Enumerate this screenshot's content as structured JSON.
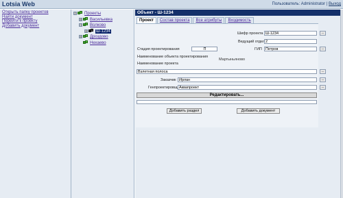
{
  "app": {
    "title": "Lotsia Web"
  },
  "header": {
    "user_prefix": "Пользователь: Administrator",
    "separator": "|",
    "exit_link": "Выход"
  },
  "left_menu": [
    {
      "label": "Открыть папку проектов"
    },
    {
      "label": "Найти документ"
    },
    {
      "label": "Перейти к проекту"
    },
    {
      "label": "Добавить документ"
    }
  ],
  "tree": {
    "root": {
      "toggle": "⊟",
      "label": "Проекты"
    },
    "items": [
      {
        "toggle": "⊞",
        "label": "Васильевка"
      },
      {
        "toggle": "⊟",
        "label": "Волково"
      },
      {
        "toggle": "⊞",
        "label": "Ш-1234",
        "selected": true
      },
      {
        "toggle": "⊞",
        "label": "Дроздово"
      },
      {
        "toggle": "",
        "label": "Нехаево"
      }
    ]
  },
  "object": {
    "title": "Объект - Ш-1234"
  },
  "tabs": [
    {
      "label": "Проект"
    },
    {
      "label": "Состав проекта"
    },
    {
      "label": "Все атрибуты"
    },
    {
      "label": "Входимость"
    }
  ],
  "form": {
    "cipher_label": "Шифр проекта",
    "cipher_value": "Ш-1234",
    "lead_dept_label": "Ведущий отдел",
    "lead_dept_value": "2",
    "stage_label": "Стадия проектирования",
    "stage_value": "П",
    "gip_label": "ГИП",
    "gip_value": "Петров",
    "object_name_label": "Наименование объекта проектирования",
    "object_name_value": "Мартыньяново",
    "project_name_label": "Наименование проекта",
    "project_name_value": "Взлетная полоса",
    "customer_label": "Заказчик",
    "customer_value": "Ирлан",
    "gen_designer_label": "Генпроектировщик",
    "gen_designer_value": "Аквапроект",
    "dots": "..."
  },
  "buttons": {
    "edit": "Редактировать...",
    "add_section": "Добавить раздел",
    "add_document": "Добавить документ"
  }
}
